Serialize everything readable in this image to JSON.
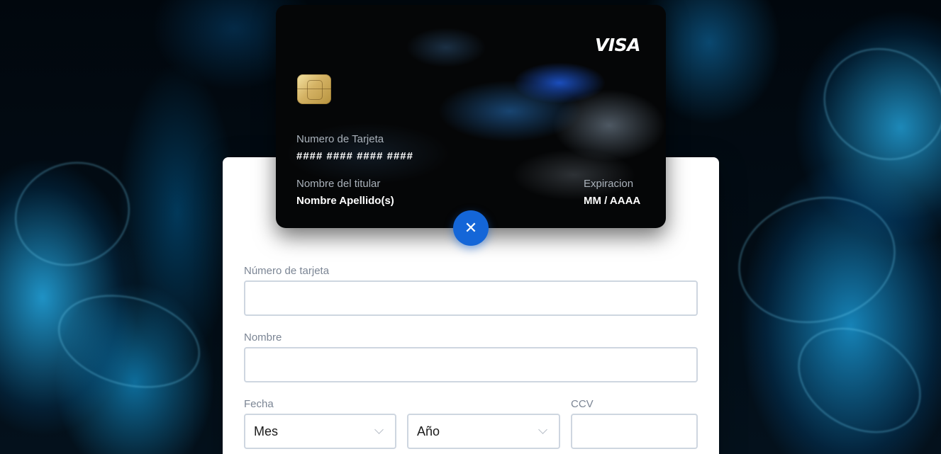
{
  "card": {
    "brand": "VISA",
    "number_label": "Numero de Tarjeta",
    "number_value": "#### #### #### ####",
    "holder_label": "Nombre del titular",
    "holder_value": "Nombre Apellido(s)",
    "expiry_label": "Expiracion",
    "expiry_value": "MM / AAAA"
  },
  "toggle_button": {
    "icon": "close-icon",
    "glyph": "✕",
    "color": "#1466d8"
  },
  "form": {
    "card_number_label": "Número de tarjeta",
    "card_number_value": "",
    "name_label": "Nombre",
    "name_value": "",
    "date_label": "Fecha",
    "month_selected": "Mes",
    "year_selected": "Año",
    "ccv_label": "CCV",
    "ccv_value": ""
  }
}
